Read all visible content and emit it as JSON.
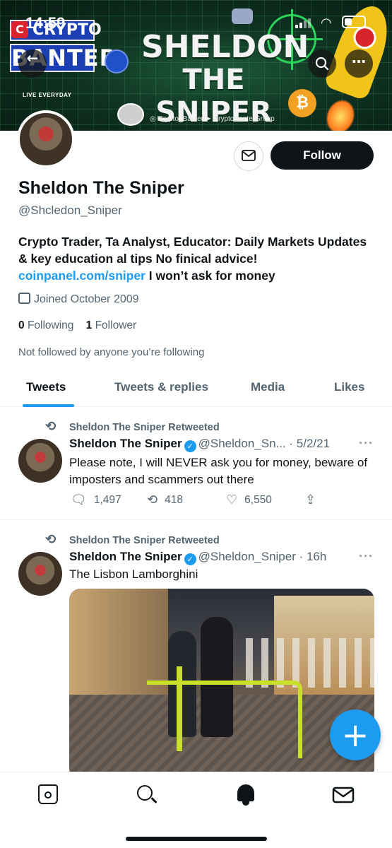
{
  "status_bar": {
    "time": "14:59"
  },
  "banner": {
    "logo_top": "CRYPTO",
    "logo_bottom": "BANTER",
    "logo_tagline": "LIVE EVERYDAY",
    "title_line1": "SHELDON",
    "title_line2": "THE SNIPER",
    "socials": "◎ Crypto_Banter   ➤ CryptoBanterGroup"
  },
  "header_buttons": {
    "back": "←",
    "search": "search",
    "more": "…"
  },
  "profile": {
    "name": "Sheldon The Sniper",
    "handle": "@Shcledon_Sniper",
    "bio_text": "Crypto Trader, Ta Analyst, Educator: Daily Markets Updates & key education al tips No finical advice!",
    "bio_link": "coinpanel.com/sniper",
    "bio_tail": " I won’t ask for money",
    "joined": "Joined October 2009",
    "following_count": "0",
    "following_label": "Following",
    "followers_count": "1",
    "followers_label": "Follower",
    "not_followed": "Not followed by anyone you’re following",
    "follow_label": "Follow"
  },
  "tabs": [
    {
      "label": "Tweets",
      "active": true
    },
    {
      "label": "Tweets & replies"
    },
    {
      "label": "Media"
    },
    {
      "label": "Likes"
    }
  ],
  "tweets": [
    {
      "retweet_label": "Sheldon The Sniper Retweeted",
      "name": "Sheldon The Sniper",
      "handle_time": "@Sheldon_Sn... · 5/2/21",
      "text": "Please note, I will NEVER ask you for money, beware of imposters and scammers out there",
      "replies": "1,497",
      "retweets": "418",
      "likes": "6,550"
    },
    {
      "retweet_label": "Sheldon The Sniper Retweeted",
      "name": "Sheldon The Sniper",
      "handle_time": "@Sheldon_Sniper · 16h",
      "text": "The Lisbon Lamborghini"
    }
  ],
  "fab_label": "+",
  "colors": {
    "accent": "#1d9bf0",
    "text": "#0f1419",
    "muted": "#536471"
  }
}
